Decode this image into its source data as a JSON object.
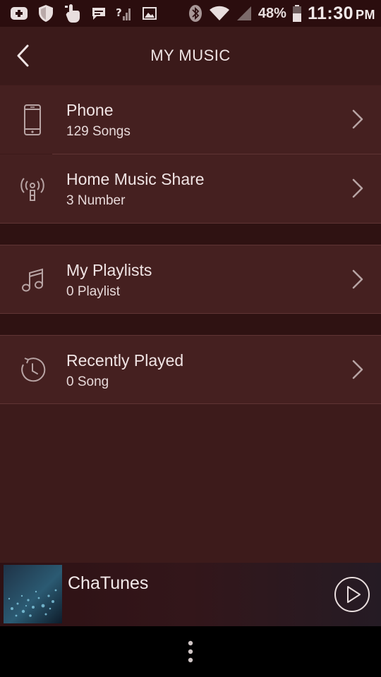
{
  "status_bar": {
    "battery_percent": "48%",
    "time": "11:30",
    "ampm": "PM"
  },
  "header": {
    "title": "MY MUSIC"
  },
  "rows": [
    {
      "title": "Phone",
      "subtitle": "129 Songs",
      "icon": "phone-icon"
    },
    {
      "title": "Home Music Share",
      "subtitle": "3 Number",
      "icon": "broadcast-icon"
    },
    {
      "title": "My Playlists",
      "subtitle": "0 Playlist",
      "icon": "music-note-icon"
    },
    {
      "title": "Recently Played",
      "subtitle": "0 Song",
      "icon": "clock-icon"
    }
  ],
  "player": {
    "title": "ChaTunes"
  },
  "colors": {
    "background": "#3d1b1b",
    "row": "#452020",
    "status_bar": "#2b0d0e",
    "text": "#efe3e3"
  }
}
